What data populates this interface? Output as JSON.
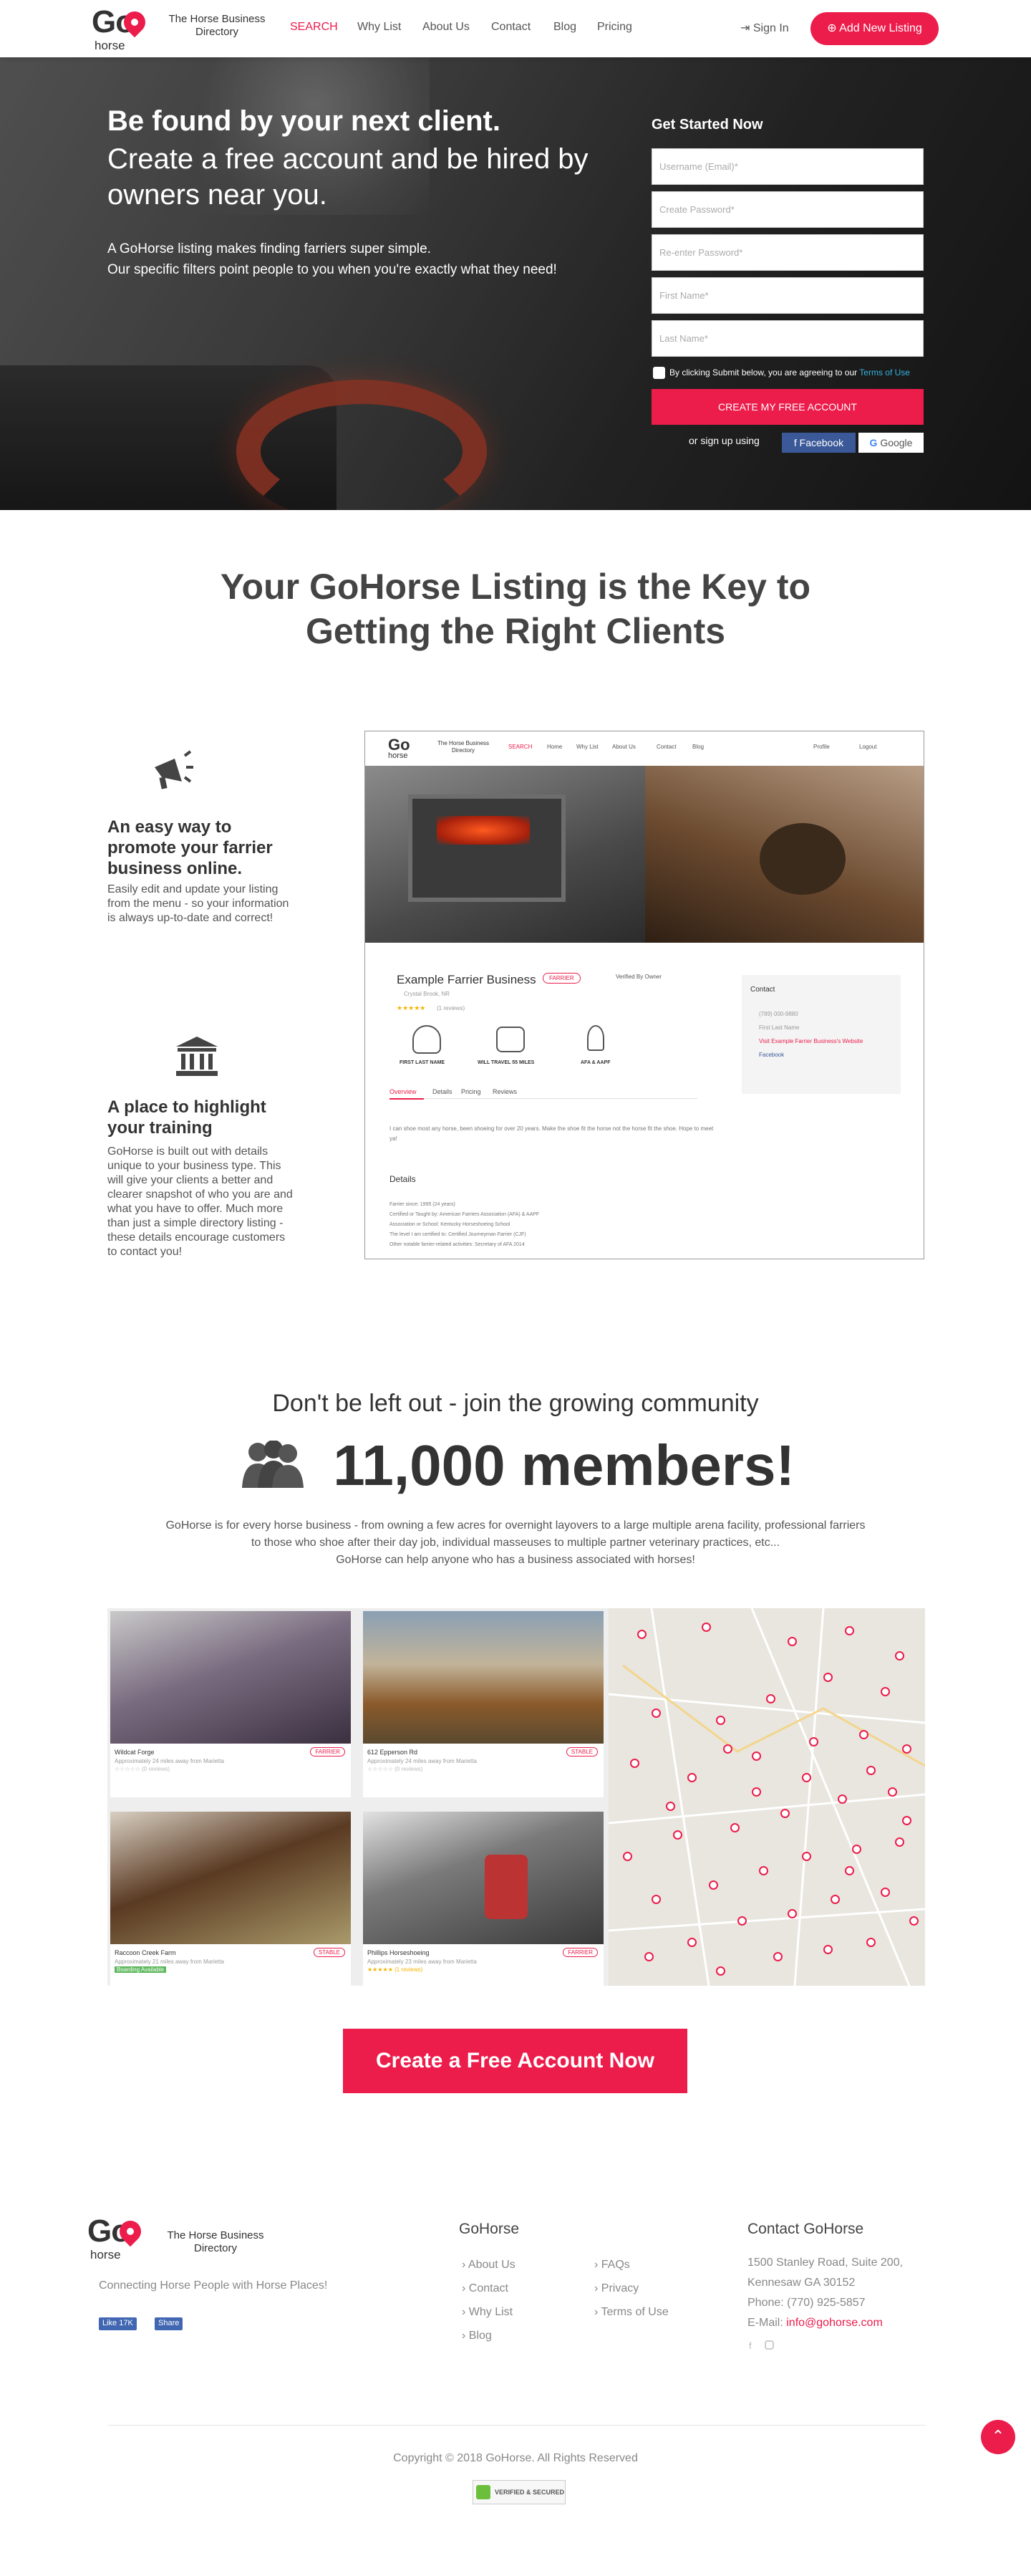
{
  "header": {
    "logo_go": "Go",
    "logo_horse": "horse",
    "tagline": "The Horse Business Directory",
    "nav": [
      "SEARCH",
      "Why List",
      "About Us",
      "Contact",
      "Blog",
      "Pricing"
    ],
    "signin": "Sign In",
    "add_listing": "Add New Listing",
    "accent": "#ec1c4b"
  },
  "hero": {
    "headline": "Be found by your next client.",
    "subheadline": "Create a free account and be hired by owners near you.",
    "text1": "A GoHorse listing makes finding farriers super simple.",
    "text2": "Our specific filters point people to you when you're exactly what they need!"
  },
  "form": {
    "title": "Get Started Now",
    "username_ph": "Username (Email)*",
    "password_ph": "Create Password*",
    "reenter_ph": "Re-enter Password*",
    "first_ph": "First Name*",
    "last_ph": "Last Name*",
    "terms_prefix": "By clicking Submit below, you are agreeing to our",
    "terms_link": "Terms of Use",
    "submit": "CREATE MY FREE ACCOUNT",
    "or": "or sign up using",
    "facebook": "Facebook",
    "google": "Google"
  },
  "section2": {
    "title_line1": "Your GoHorse Listing is the Key to",
    "title_line2": "Getting the Right Clients",
    "feat1_title": "An easy way to promote your farrier business online.",
    "feat1_text": "Easily edit and update your listing from the menu - so your information is always up-to-date and correct!",
    "feat2_title": "A place to highlight your training",
    "feat2_text": "GoHorse is built out with details unique to your business type. This will give your clients a better and clearer snapshot of who you are and what you have to offer. Much more than just a simple directory listing - these details encourage customers to contact you!"
  },
  "mockup": {
    "tagline": "The Horse Business Directory",
    "nav": [
      "SEARCH",
      "Home",
      "Why List",
      "About Us",
      "Contact",
      "Blog"
    ],
    "profile": "Profile",
    "logout": "Logout",
    "business": "Example Farrier Business",
    "badge": "FARRIER",
    "verified": "Verified By Owner",
    "location": "Crystal Brook, NR",
    "reviews": "(1 reviews)",
    "icons": [
      "FIRST LAST NAME",
      "WILL TRAVEL 55 MILES",
      "AFA & AAPF"
    ],
    "tabs": [
      "Overview",
      "Details",
      "Pricing",
      "Reviews"
    ],
    "overview_text": "I can shoe most any horse, been shoeing for over 20 years. Make the shoe fit the horse not the horse fit the shoe. Hope to meet ya!",
    "details_title": "Details",
    "details": [
      "Farrier since: 1995 (24 years)",
      "Certified or Taught by: American Farriers Association (AFA) & AAPF",
      "Association or School: Kentucky Horseshoeing School",
      "The level I am certified to: Certified Journeyman Farrier (CJF)",
      "Other notable farrier-related activities: Secretary of AFA 2014"
    ],
    "contact_title": "Contact",
    "contact": [
      "(789) 000-9880",
      "First Last Name",
      "Visit Example Farrier Business's Website",
      "Facebook"
    ]
  },
  "community": {
    "title": "Don't be left out - join the growing community",
    "members": "11,000 members!",
    "line1": "GoHorse is for every horse business - from owning a few acres for overnight layovers to a large multiple arena facility, professional farriers",
    "line2": "to those who shoe after their day job, individual masseuses to multiple partner veterinary practices, etc...",
    "line3": "GoHorse can help anyone who has a business associated with horses!"
  },
  "gallery": {
    "cards": [
      {
        "name": "Wildcat Forge",
        "tag": "FARRIER",
        "sub": "Approximately 24 miles away from Marietta",
        "stars": "☆☆☆☆☆ (0 reviews)"
      },
      {
        "name": "612 Epperson Rd",
        "tag": "STABLE",
        "sub": "Approximately 24 miles away from Marietta",
        "stars": "☆☆☆☆☆ (0 reviews)"
      },
      {
        "name": "Raccoon Creek Farm",
        "tag": "STABLE",
        "sub": "Approximately 21 miles away from Marietta",
        "stars": "Boarding Available"
      },
      {
        "name": "Phillips Horseshoeing",
        "tag": "FARRIER",
        "sub": "Approximately 23 miles away from Marietta",
        "stars": "★★★★★ (1 reviews)"
      }
    ]
  },
  "cta": "Create a Free Account Now",
  "footer": {
    "tagline": "The Horse Business Directory",
    "slogan": "Connecting Horse People with Horse Places!",
    "like": "Like 17K",
    "share": "Share",
    "col2_title": "GoHorse",
    "links_a": [
      "About Us",
      "Contact",
      "Why List",
      "Blog"
    ],
    "links_b": [
      "FAQs",
      "Privacy",
      "Terms of Use"
    ],
    "col3_title": "Contact GoHorse",
    "address1": "1500 Stanley Road, Suite 200,",
    "address2": "Kennesaw GA 30152",
    "phone": "Phone: (770) 925-5857",
    "email_label": "E-Mail:",
    "email": "info@gohorse.com",
    "copyright": "Copyright © 2018 GoHorse. All Rights Reserved",
    "secured": "VERIFIED & SECURED"
  }
}
